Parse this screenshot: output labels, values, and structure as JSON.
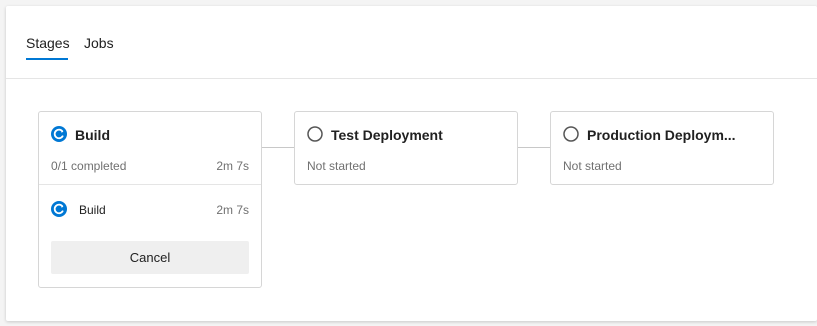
{
  "tabs": [
    {
      "label": "Stages",
      "active": true
    },
    {
      "label": "Jobs",
      "active": false
    }
  ],
  "stages": [
    {
      "name": "Build",
      "status": "running",
      "status_icon": "running-icon",
      "progress_text": "0/1 completed",
      "duration": "2m 7s",
      "jobs": [
        {
          "name": "Build",
          "status_icon": "running-icon",
          "duration": "2m 7s"
        }
      ],
      "cancel_label": "Cancel"
    },
    {
      "name": "Test Deployment",
      "status": "not-started",
      "status_icon": "pending-circle-icon",
      "status_text": "Not started"
    },
    {
      "name": "Production Deploym...",
      "status": "not-started",
      "status_icon": "pending-circle-icon",
      "status_text": "Not started"
    }
  ],
  "colors": {
    "accent": "#0078d4",
    "pending_icon": "#555555",
    "border": "#d6d6d6",
    "secondary_text": "#707070"
  }
}
